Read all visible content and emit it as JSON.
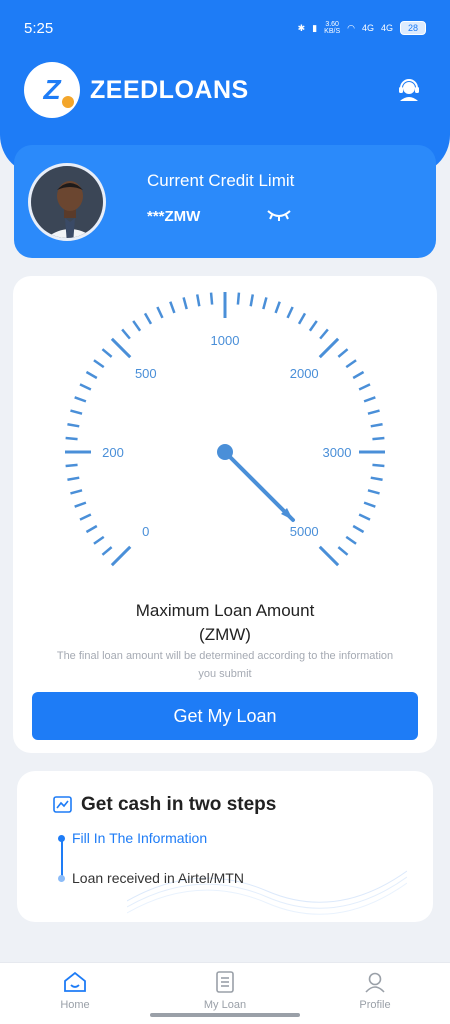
{
  "status_bar": {
    "time": "5:25",
    "network_speed_value": "3.60",
    "network_speed_unit": "KB/S",
    "signal1": "4G",
    "signal2": "4G",
    "battery": "28"
  },
  "header": {
    "logo_letter": "Z",
    "brand_name": "ZEEDLOANS"
  },
  "credit": {
    "title": "Current Credit Limit",
    "value": "***ZMW"
  },
  "gauge": {
    "labels": [
      "0",
      "200",
      "500",
      "1000",
      "2000",
      "3000",
      "5000"
    ],
    "needle_value": "5000"
  },
  "loan": {
    "title_line1": "Maximum Loan Amount",
    "title_line2": "(ZMW)",
    "note": "The final loan amount will be determined according to the information you submit",
    "button_label": "Get My Loan"
  },
  "steps": {
    "title": "Get cash in two steps",
    "step1": "Fill In The Information",
    "step2": "Loan received in Airtel/MTN"
  },
  "tabs": [
    {
      "label": "Home",
      "icon": "home-icon",
      "active": true
    },
    {
      "label": "My Loan",
      "icon": "document-icon",
      "active": false
    },
    {
      "label": "Profile",
      "icon": "person-icon",
      "active": false
    }
  ],
  "colors": {
    "primary": "#1e7cf6",
    "gauge": "#4a8fd8",
    "background": "#eef1f6"
  }
}
